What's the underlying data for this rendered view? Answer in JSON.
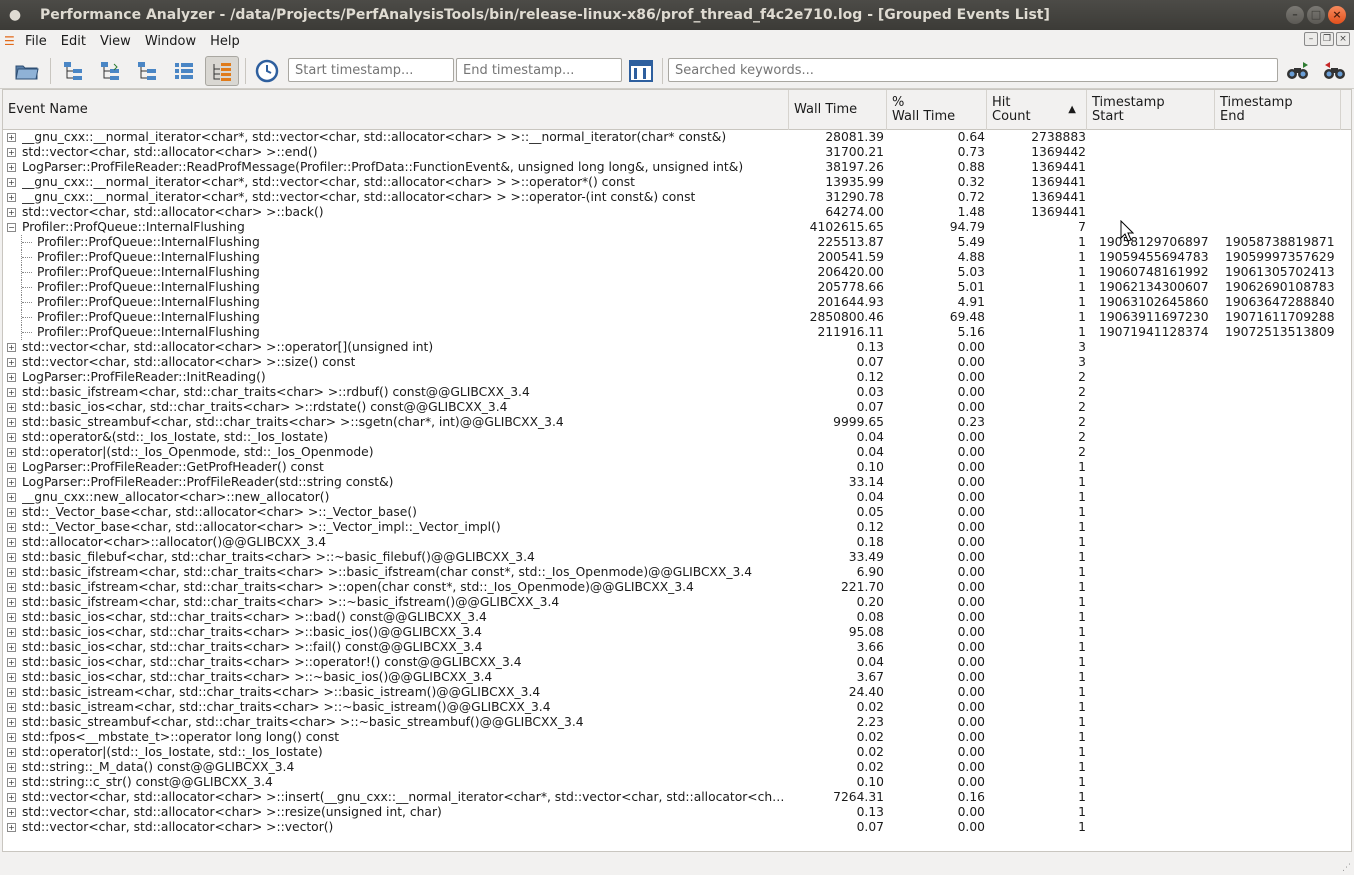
{
  "window": {
    "title": "Performance Analyzer - /data/Projects/PerfAnalysisTools/bin/release-linux-x86/prof_thread_f4c2e710.log - [Grouped Events List]"
  },
  "menubar": {
    "items": [
      {
        "label": "File"
      },
      {
        "label": "Edit"
      },
      {
        "label": "View"
      },
      {
        "label": "Window"
      },
      {
        "label": "Help"
      }
    ]
  },
  "toolbar": {
    "start_placeholder": "Start timestamp...",
    "end_placeholder": "End timestamp...",
    "search_placeholder": "Searched keywords...",
    "icons": [
      "open-folder-icon",
      "tree-view-1-icon",
      "tree-view-2-icon",
      "tree-view-3-icon",
      "flat-list-icon",
      "grouped-events-icon",
      "clock-icon",
      "timeline-icon",
      "find-next-icon",
      "find-previous-icon"
    ]
  },
  "table": {
    "columns": [
      {
        "line1": "Event Name",
        "line2": ""
      },
      {
        "line1": "Wall Time",
        "line2": ""
      },
      {
        "line1": "%",
        "line2": "Wall Time"
      },
      {
        "line1": "Hit",
        "line2": "Count"
      },
      {
        "line1": "Timestamp",
        "line2": "Start"
      },
      {
        "line1": "Timestamp",
        "line2": "End"
      }
    ],
    "rows": [
      {
        "exp": "+",
        "name": "__gnu_cxx::__normal_iterator<char*, std::vector<char, std::allocator<char> > >::__normal_iterator(char* const&)",
        "wall": "28081.39",
        "pct": "0.64",
        "hits": "2738883",
        "ts": "",
        "te": ""
      },
      {
        "exp": "+",
        "name": "std::vector<char, std::allocator<char> >::end()",
        "wall": "31700.21",
        "pct": "0.73",
        "hits": "1369442",
        "ts": "",
        "te": ""
      },
      {
        "exp": "+",
        "name": "LogParser::ProfFileReader::ReadProfMessage(Profiler::ProfData::FunctionEvent&, unsigned long long&, unsigned int&)",
        "wall": "38197.26",
        "pct": "0.88",
        "hits": "1369441",
        "ts": "",
        "te": ""
      },
      {
        "exp": "+",
        "name": "__gnu_cxx::__normal_iterator<char*, std::vector<char, std::allocator<char> > >::operator*() const",
        "wall": "13935.99",
        "pct": "0.32",
        "hits": "1369441",
        "ts": "",
        "te": ""
      },
      {
        "exp": "+",
        "name": "__gnu_cxx::__normal_iterator<char*, std::vector<char, std::allocator<char> > >::operator-(int const&) const",
        "wall": "31290.78",
        "pct": "0.72",
        "hits": "1369441",
        "ts": "",
        "te": ""
      },
      {
        "exp": "+",
        "name": "std::vector<char, std::allocator<char> >::back()",
        "wall": "64274.00",
        "pct": "1.48",
        "hits": "1369441",
        "ts": "",
        "te": ""
      },
      {
        "exp": "-",
        "name": "Profiler::ProfQueue::InternalFlushing",
        "wall": "4102615.65",
        "pct": "94.79",
        "hits": "7",
        "ts": "",
        "te": ""
      },
      {
        "exp": "child",
        "name": "Profiler::ProfQueue::InternalFlushing",
        "wall": "225513.87",
        "pct": "5.49",
        "hits": "1",
        "ts": "19058129706897",
        "te": "19058738819871"
      },
      {
        "exp": "child",
        "name": "Profiler::ProfQueue::InternalFlushing",
        "wall": "200541.59",
        "pct": "4.88",
        "hits": "1",
        "ts": "19059455694783",
        "te": "19059997357629"
      },
      {
        "exp": "child",
        "name": "Profiler::ProfQueue::InternalFlushing",
        "wall": "206420.00",
        "pct": "5.03",
        "hits": "1",
        "ts": "19060748161992",
        "te": "19061305702413"
      },
      {
        "exp": "child",
        "name": "Profiler::ProfQueue::InternalFlushing",
        "wall": "205778.66",
        "pct": "5.01",
        "hits": "1",
        "ts": "19062134300607",
        "te": "19062690108783"
      },
      {
        "exp": "child",
        "name": "Profiler::ProfQueue::InternalFlushing",
        "wall": "201644.93",
        "pct": "4.91",
        "hits": "1",
        "ts": "19063102645860",
        "te": "19063647288840"
      },
      {
        "exp": "child",
        "name": "Profiler::ProfQueue::InternalFlushing",
        "wall": "2850800.46",
        "pct": "69.48",
        "hits": "1",
        "ts": "19063911697230",
        "te": "19071611709288"
      },
      {
        "exp": "child",
        "name": "Profiler::ProfQueue::InternalFlushing",
        "wall": "211916.11",
        "pct": "5.16",
        "hits": "1",
        "ts": "19071941128374",
        "te": "19072513513809"
      },
      {
        "exp": "+",
        "name": "std::vector<char, std::allocator<char> >::operator[](unsigned int)",
        "wall": "0.13",
        "pct": "0.00",
        "hits": "3",
        "ts": "",
        "te": ""
      },
      {
        "exp": "+",
        "name": "std::vector<char, std::allocator<char> >::size() const",
        "wall": "0.07",
        "pct": "0.00",
        "hits": "3",
        "ts": "",
        "te": ""
      },
      {
        "exp": "+",
        "name": "LogParser::ProfFileReader::InitReading()",
        "wall": "0.12",
        "pct": "0.00",
        "hits": "2",
        "ts": "",
        "te": ""
      },
      {
        "exp": "+",
        "name": "std::basic_ifstream<char, std::char_traits<char> >::rdbuf() const@@GLIBCXX_3.4",
        "wall": "0.03",
        "pct": "0.00",
        "hits": "2",
        "ts": "",
        "te": ""
      },
      {
        "exp": "+",
        "name": "std::basic_ios<char, std::char_traits<char> >::rdstate() const@@GLIBCXX_3.4",
        "wall": "0.07",
        "pct": "0.00",
        "hits": "2",
        "ts": "",
        "te": ""
      },
      {
        "exp": "+",
        "name": "std::basic_streambuf<char, std::char_traits<char> >::sgetn(char*, int)@@GLIBCXX_3.4",
        "wall": "9999.65",
        "pct": "0.23",
        "hits": "2",
        "ts": "",
        "te": ""
      },
      {
        "exp": "+",
        "name": "std::operator&(std::_Ios_Iostate, std::_Ios_Iostate)",
        "wall": "0.04",
        "pct": "0.00",
        "hits": "2",
        "ts": "",
        "te": ""
      },
      {
        "exp": "+",
        "name": "std::operator|(std::_Ios_Openmode, std::_Ios_Openmode)",
        "wall": "0.04",
        "pct": "0.00",
        "hits": "2",
        "ts": "",
        "te": ""
      },
      {
        "exp": "+",
        "name": "LogParser::ProfFileReader::GetProfHeader() const",
        "wall": "0.10",
        "pct": "0.00",
        "hits": "1",
        "ts": "",
        "te": ""
      },
      {
        "exp": "+",
        "name": "LogParser::ProfFileReader::ProfFileReader(std::string const&)",
        "wall": "33.14",
        "pct": "0.00",
        "hits": "1",
        "ts": "",
        "te": ""
      },
      {
        "exp": "+",
        "name": "__gnu_cxx::new_allocator<char>::new_allocator()",
        "wall": "0.04",
        "pct": "0.00",
        "hits": "1",
        "ts": "",
        "te": ""
      },
      {
        "exp": "+",
        "name": "std::_Vector_base<char, std::allocator<char> >::_Vector_base()",
        "wall": "0.05",
        "pct": "0.00",
        "hits": "1",
        "ts": "",
        "te": ""
      },
      {
        "exp": "+",
        "name": "std::_Vector_base<char, std::allocator<char> >::_Vector_impl::_Vector_impl()",
        "wall": "0.12",
        "pct": "0.00",
        "hits": "1",
        "ts": "",
        "te": ""
      },
      {
        "exp": "+",
        "name": "std::allocator<char>::allocator()@@GLIBCXX_3.4",
        "wall": "0.18",
        "pct": "0.00",
        "hits": "1",
        "ts": "",
        "te": ""
      },
      {
        "exp": "+",
        "name": "std::basic_filebuf<char, std::char_traits<char> >::~basic_filebuf()@@GLIBCXX_3.4",
        "wall": "33.49",
        "pct": "0.00",
        "hits": "1",
        "ts": "",
        "te": ""
      },
      {
        "exp": "+",
        "name": "std::basic_ifstream<char, std::char_traits<char> >::basic_ifstream(char const*, std::_Ios_Openmode)@@GLIBCXX_3.4",
        "wall": "6.90",
        "pct": "0.00",
        "hits": "1",
        "ts": "",
        "te": ""
      },
      {
        "exp": "+",
        "name": "std::basic_ifstream<char, std::char_traits<char> >::open(char const*, std::_Ios_Openmode)@@GLIBCXX_3.4",
        "wall": "221.70",
        "pct": "0.00",
        "hits": "1",
        "ts": "",
        "te": ""
      },
      {
        "exp": "+",
        "name": "std::basic_ifstream<char, std::char_traits<char> >::~basic_ifstream()@@GLIBCXX_3.4",
        "wall": "0.20",
        "pct": "0.00",
        "hits": "1",
        "ts": "",
        "te": ""
      },
      {
        "exp": "+",
        "name": "std::basic_ios<char, std::char_traits<char> >::bad() const@@GLIBCXX_3.4",
        "wall": "0.08",
        "pct": "0.00",
        "hits": "1",
        "ts": "",
        "te": ""
      },
      {
        "exp": "+",
        "name": "std::basic_ios<char, std::char_traits<char> >::basic_ios()@@GLIBCXX_3.4",
        "wall": "95.08",
        "pct": "0.00",
        "hits": "1",
        "ts": "",
        "te": ""
      },
      {
        "exp": "+",
        "name": "std::basic_ios<char, std::char_traits<char> >::fail() const@@GLIBCXX_3.4",
        "wall": "3.66",
        "pct": "0.00",
        "hits": "1",
        "ts": "",
        "te": ""
      },
      {
        "exp": "+",
        "name": "std::basic_ios<char, std::char_traits<char> >::operator!() const@@GLIBCXX_3.4",
        "wall": "0.04",
        "pct": "0.00",
        "hits": "1",
        "ts": "",
        "te": ""
      },
      {
        "exp": "+",
        "name": "std::basic_ios<char, std::char_traits<char> >::~basic_ios()@@GLIBCXX_3.4",
        "wall": "3.67",
        "pct": "0.00",
        "hits": "1",
        "ts": "",
        "te": ""
      },
      {
        "exp": "+",
        "name": "std::basic_istream<char, std::char_traits<char> >::basic_istream()@@GLIBCXX_3.4",
        "wall": "24.40",
        "pct": "0.00",
        "hits": "1",
        "ts": "",
        "te": ""
      },
      {
        "exp": "+",
        "name": "std::basic_istream<char, std::char_traits<char> >::~basic_istream()@@GLIBCXX_3.4",
        "wall": "0.02",
        "pct": "0.00",
        "hits": "1",
        "ts": "",
        "te": ""
      },
      {
        "exp": "+",
        "name": "std::basic_streambuf<char, std::char_traits<char> >::~basic_streambuf()@@GLIBCXX_3.4",
        "wall": "2.23",
        "pct": "0.00",
        "hits": "1",
        "ts": "",
        "te": ""
      },
      {
        "exp": "+",
        "name": "std::fpos<__mbstate_t>::operator long long() const",
        "wall": "0.02",
        "pct": "0.00",
        "hits": "1",
        "ts": "",
        "te": ""
      },
      {
        "exp": "+",
        "name": "std::operator|(std::_Ios_Iostate, std::_Ios_Iostate)",
        "wall": "0.02",
        "pct": "0.00",
        "hits": "1",
        "ts": "",
        "te": ""
      },
      {
        "exp": "+",
        "name": "std::string::_M_data() const@@GLIBCXX_3.4",
        "wall": "0.02",
        "pct": "0.00",
        "hits": "1",
        "ts": "",
        "te": ""
      },
      {
        "exp": "+",
        "name": "std::string::c_str() const@@GLIBCXX_3.4",
        "wall": "0.10",
        "pct": "0.00",
        "hits": "1",
        "ts": "",
        "te": ""
      },
      {
        "exp": "+",
        "name": "std::vector<char, std::allocator<char> >::insert(__gnu_cxx::__normal_iterator<char*, std::vector<char, std::allocator<char...",
        "wall": "7264.31",
        "pct": "0.16",
        "hits": "1",
        "ts": "",
        "te": ""
      },
      {
        "exp": "+",
        "name": "std::vector<char, std::allocator<char> >::resize(unsigned int, char)",
        "wall": "0.13",
        "pct": "0.00",
        "hits": "1",
        "ts": "",
        "te": ""
      },
      {
        "exp": "+",
        "name": "std::vector<char, std::allocator<char> >::vector()",
        "wall": "0.07",
        "pct": "0.00",
        "hits": "1",
        "ts": "",
        "te": ""
      }
    ]
  }
}
